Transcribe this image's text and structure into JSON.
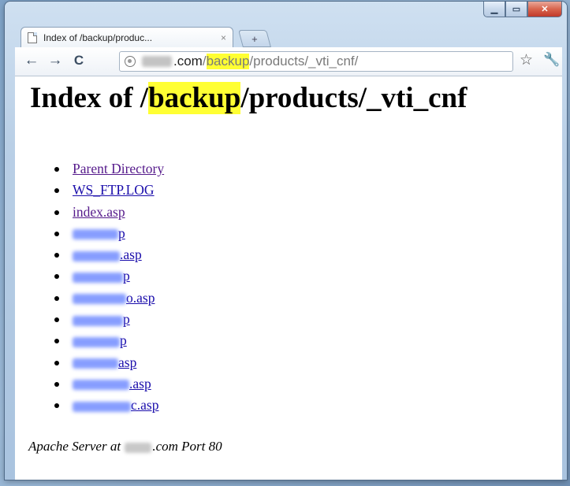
{
  "window": {
    "minimize_icon": "minimize-icon",
    "maximize_icon": "maximize-icon",
    "close_icon": "close-icon"
  },
  "tab": {
    "title": "Index of /backup/produc...",
    "close": "×",
    "new_tab": "+"
  },
  "toolbar": {
    "back": "←",
    "forward": "→",
    "reload": "C",
    "url": {
      "host_suffix": ".com",
      "slash1": "/",
      "highlight": "backup",
      "rest": "/products/_vti_cnf/"
    },
    "bookmark_star": "☆",
    "wrench": "🔧"
  },
  "page": {
    "heading_prefix": "Index of /",
    "heading_highlight": "backup",
    "heading_suffix": "/products/_vti_cnf",
    "items": [
      {
        "text": "Parent Directory"
      },
      {
        "text": "WS_FTP.LOG"
      },
      {
        "text": "index.asp"
      },
      {
        "text": "p"
      },
      {
        "text": ".asp"
      },
      {
        "text": "p"
      },
      {
        "text": "o.asp"
      },
      {
        "text": "p"
      },
      {
        "text": "p"
      },
      {
        "text": "asp"
      },
      {
        "text": ".asp"
      },
      {
        "text": "c.asp"
      }
    ],
    "footer_prefix": "Apache Server at ",
    "footer_suffix": ".com Port 80"
  },
  "colors": {
    "highlight": "#ffff33",
    "link": "#1a0dab",
    "visited_link": "#551a8b"
  }
}
